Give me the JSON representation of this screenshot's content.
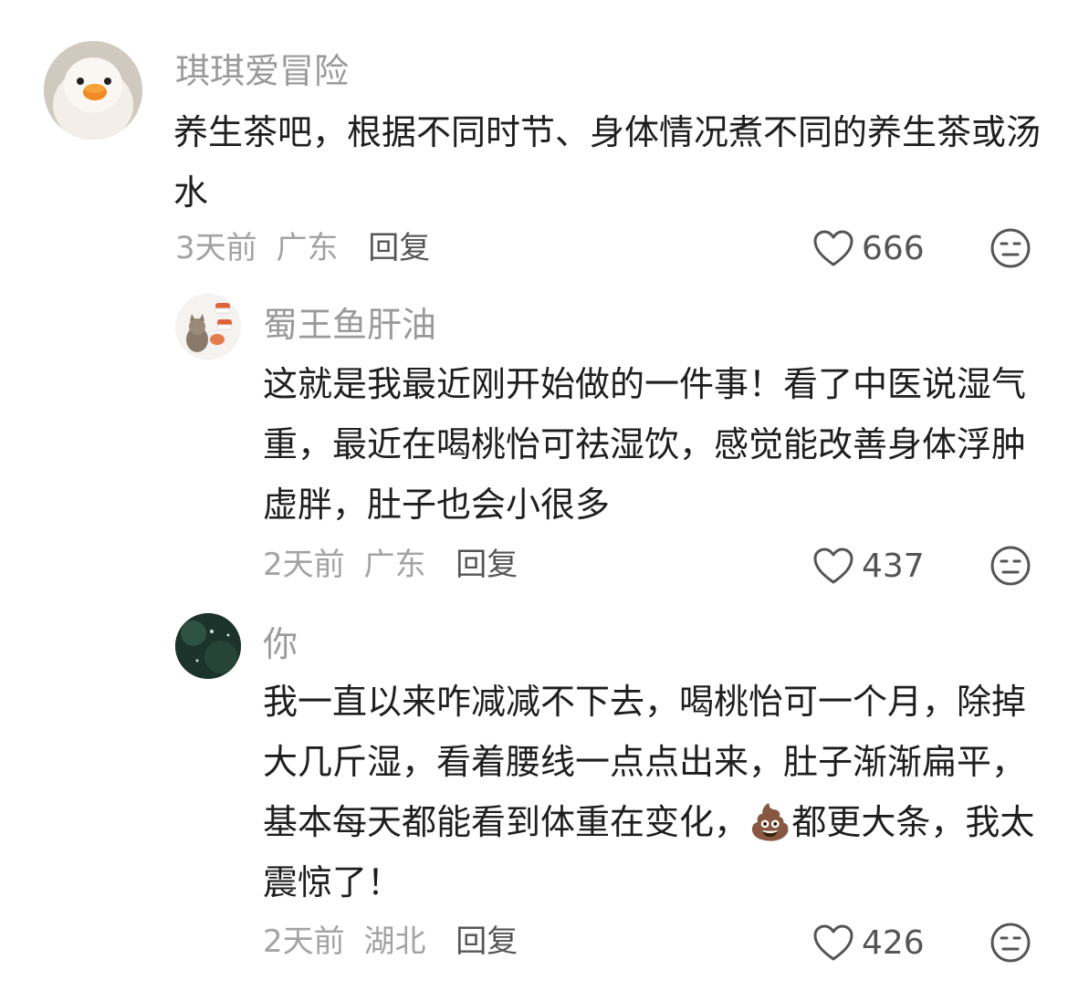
{
  "comments": [
    {
      "username": "琪琪爱冒险",
      "text": "养生茶吧，根据不同时节、身体情况煮不同的养生茶或汤水",
      "time": "3天前",
      "location": "广东",
      "reply_label": "回复",
      "likes": "666",
      "avatar_icon": "duck-plush-avatar"
    },
    {
      "username": "蜀王鱼肝油",
      "text": "这就是我最近刚开始做的一件事！看了中医说湿气重，最近在喝桃怡可祛湿饮，感觉能改善身体浮肿虚胖，肚子也会小很多",
      "time": "2天前",
      "location": "广东",
      "reply_label": "回复",
      "likes": "437",
      "avatar_icon": "cat-sushi-avatar"
    },
    {
      "username": "你",
      "text_before_emoji": "我一直以来咋减减不下去，喝桃怡可一个月，除掉大几斤湿，看着腰线一点点出来，肚子渐渐扁平，基本每天都能看到体重在变化，",
      "emoji": "💩",
      "text_after_emoji": "都更大条，我太震惊了！",
      "time": "2天前",
      "location": "湖北",
      "reply_label": "回复",
      "likes": "426",
      "avatar_icon": "dark-green-avatar"
    }
  ],
  "colors": {
    "username": "#9a9a9a",
    "body_text": "#1e1e1e",
    "meta": "#a3a3a3",
    "reply": "#555555",
    "icon": "#555555"
  }
}
